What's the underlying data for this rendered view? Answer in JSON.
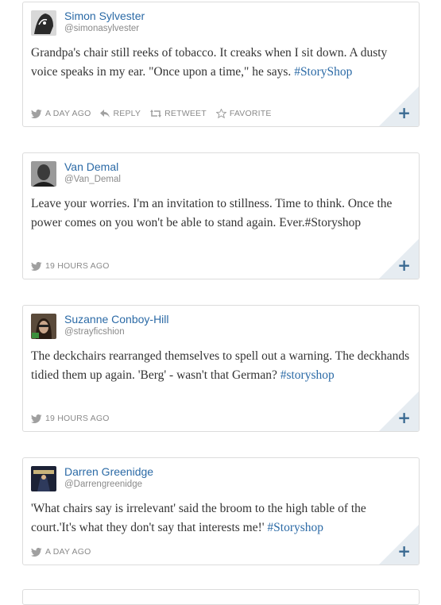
{
  "tweets": [
    {
      "name": "Simon Sylvester",
      "handle": "@simonasylvester",
      "text_parts": [
        "Grandpa's chair still reeks of tobacco. It creaks when I sit down. A dusty voice speaks in my ear. \"Once upon a time,\" he says. ",
        "#StoryShop"
      ],
      "time": "A DAY AGO",
      "actions": {
        "reply": "REPLY",
        "retweet": "RETWEET",
        "favorite": "FAVORITE"
      }
    },
    {
      "name": "Van Demal",
      "handle": "@Van_Demal",
      "text_parts": [
        "Leave your worries. I'm an invitation to stillness. Time to think. Once the power comes on you won't be able to stand again. Ever.#Storyshop"
      ],
      "time": "19 HOURS AGO"
    },
    {
      "name": "Suzanne Conboy-Hill",
      "handle": "@strayficshion",
      "text_parts": [
        "The deckchairs rearranged themselves to spell out a warning. The deckhands tidied them up again. 'Berg' - wasn't that German? ",
        "#storyshop"
      ],
      "time": "19 HOURS AGO"
    },
    {
      "name": "Darren Greenidge",
      "handle": "@Darrengreenidge",
      "text_parts": [
        "'What chairs say is irrelevant' said the broom to the high table of the court.'It's what they don't say that interests me!' ",
        "#Storyshop"
      ],
      "time": "A DAY AGO"
    }
  ],
  "colors": {
    "link": "#2b6aa6",
    "meta": "#8a8a8a",
    "corner": "#e6ecf1",
    "plus": "#3a6a92"
  },
  "icons": {
    "source": "bird-icon",
    "reply": "reply-icon",
    "retweet": "retweet-icon",
    "favorite": "star-icon",
    "expand": "plus-icon"
  }
}
